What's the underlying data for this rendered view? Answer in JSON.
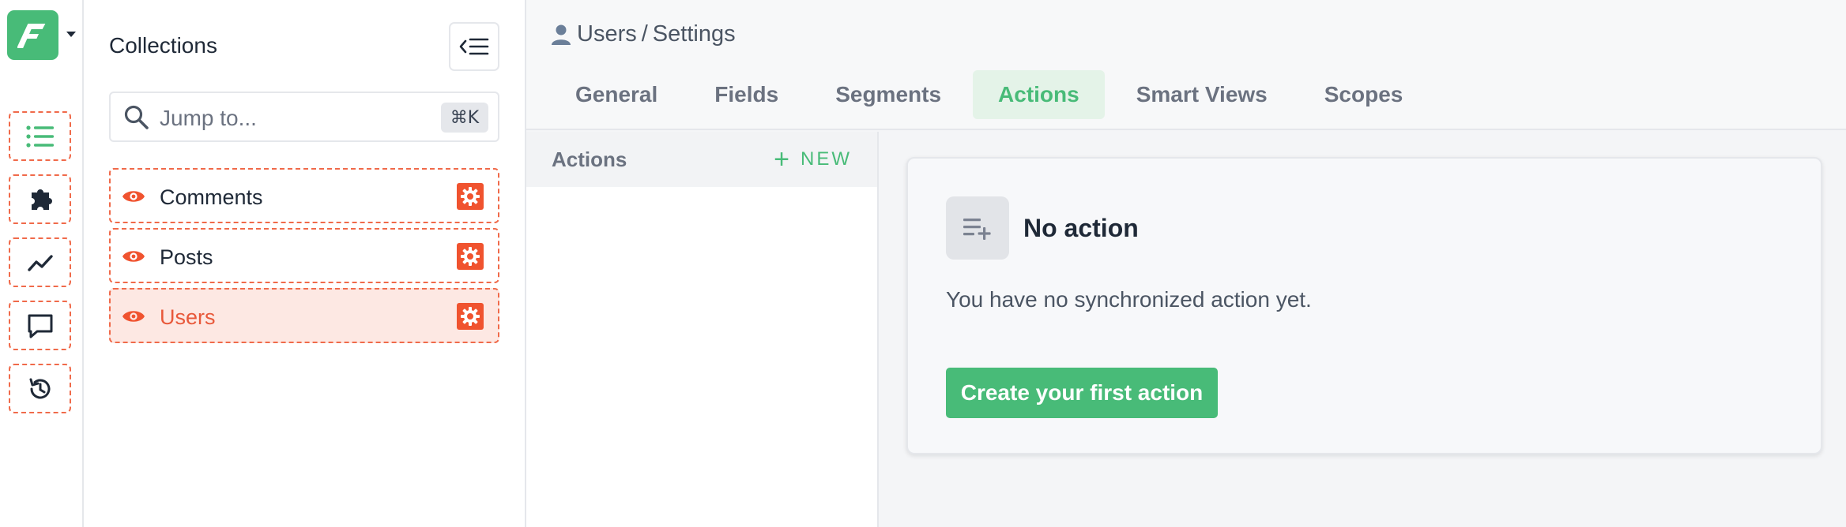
{
  "colors": {
    "brand_green": "#48bb78",
    "danger_orange": "#f0532f",
    "active_row_bg": "#fde8e3"
  },
  "logo": {
    "letter": "F",
    "icon": "forest-admin-logo"
  },
  "rail": {
    "items": [
      {
        "icon": "list-icon"
      },
      {
        "icon": "puzzle-icon"
      },
      {
        "icon": "chart-line-icon"
      },
      {
        "icon": "chat-icon"
      },
      {
        "icon": "history-icon"
      }
    ]
  },
  "collections": {
    "title": "Collections",
    "search": {
      "placeholder": "Jump to...",
      "shortcut": "⌘K"
    },
    "items": [
      {
        "label": "Comments",
        "active": false
      },
      {
        "label": "Posts",
        "active": false
      },
      {
        "label": "Users",
        "active": true
      }
    ]
  },
  "header": {
    "breadcrumb": {
      "collection": "Users",
      "separator": "/",
      "page": "Settings"
    },
    "tabs": [
      {
        "label": "General",
        "active": false
      },
      {
        "label": "Fields",
        "active": false
      },
      {
        "label": "Segments",
        "active": false
      },
      {
        "label": "Actions",
        "active": true
      },
      {
        "label": "Smart Views",
        "active": false
      },
      {
        "label": "Scopes",
        "active": false
      }
    ]
  },
  "actions_panel": {
    "title": "Actions",
    "new_label": "NEW",
    "new_icon": "+"
  },
  "empty_state": {
    "title": "No action",
    "description": "You have no synchronized action yet.",
    "button_label": "Create your first action"
  }
}
